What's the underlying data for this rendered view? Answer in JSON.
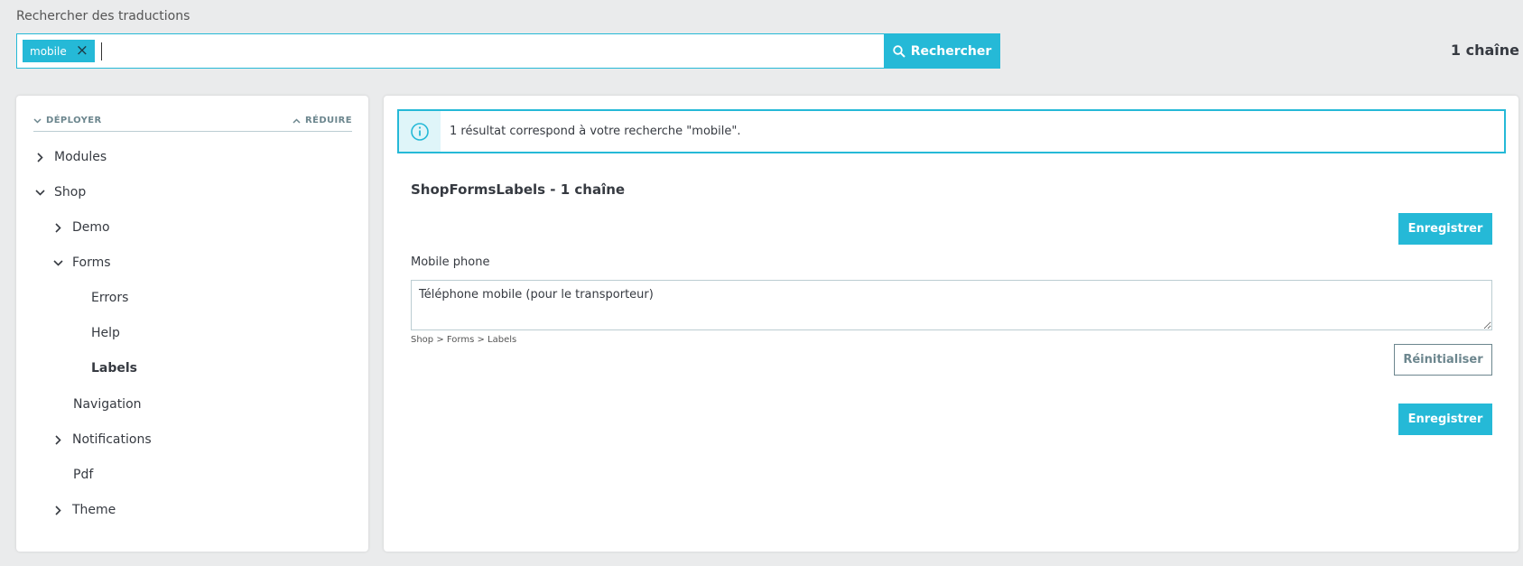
{
  "search": {
    "title": "Rechercher des traductions",
    "tag": "mobile",
    "button_label": "Rechercher",
    "count": "1 chaîne"
  },
  "tree": {
    "expand_label": "DÉPLOYER",
    "collapse_label": "RÉDUIRE",
    "items": [
      {
        "label": "Modules",
        "state": "collapsed"
      },
      {
        "label": "Shop",
        "state": "expanded"
      },
      {
        "label": "Demo",
        "state": "collapsed"
      },
      {
        "label": "Forms",
        "state": "expanded"
      },
      {
        "label": "Errors",
        "state": "leaf"
      },
      {
        "label": "Help",
        "state": "leaf"
      },
      {
        "label": "Labels",
        "state": "leaf-active"
      },
      {
        "label": "Navigation",
        "state": "leaf"
      },
      {
        "label": "Notifications",
        "state": "collapsed"
      },
      {
        "label": "Pdf",
        "state": "leaf"
      },
      {
        "label": "Theme",
        "state": "collapsed"
      }
    ]
  },
  "results": {
    "alert_text": "1 résultat correspond à votre recherche \"mobile\".",
    "group_title": "ShopFormsLabels - 1 chaîne",
    "save_label": "Enregistrer",
    "source_text": "Mobile phone",
    "translation_value": "Téléphone mobile (pour le transporteur)",
    "breadcrumb": "Shop > Forms > Labels",
    "reset_label": "Réinitialiser"
  },
  "colors": {
    "accent": "#25b9d7",
    "background": "#eaebec",
    "text": "#363a41"
  }
}
